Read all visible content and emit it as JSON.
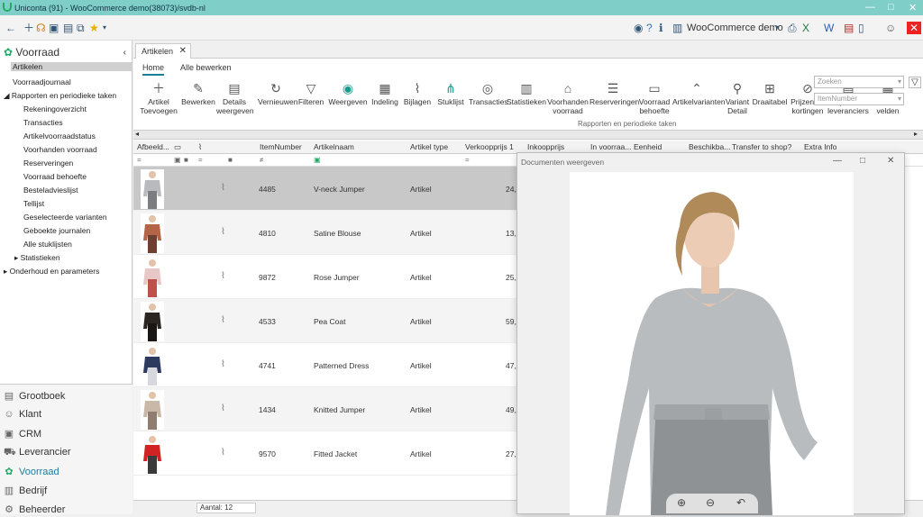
{
  "titlebar": {
    "title": "Uniconta (91)  - WooCommerce demo(38073)/svdb-nl"
  },
  "appbar": {
    "company": "WooCommerce demo"
  },
  "sidebar": {
    "header": "Voorraad",
    "items": [
      "Artikelen",
      "Voorraadjournaal",
      "Rapporten en periodieke taken",
      "Rekeningoverzicht",
      "Transacties",
      "Artikelvoorraadstatus",
      "Voorhanden voorraad",
      "Reserveringen",
      "Voorraad behoefte",
      "Besteladvieslijst",
      "Tellijst",
      "Geselecteerde varianten",
      "Geboekte journalen",
      "Alle stuklijsten",
      "Statistieken",
      "Onderhoud en parameters"
    ]
  },
  "modules": [
    "Grootboek",
    "Klant",
    "CRM",
    "Leverancier",
    "Voorraad",
    "Bedrijf",
    "Beheerder"
  ],
  "doctab": {
    "label": "Artikelen"
  },
  "ribbon": {
    "tabs": [
      "Home",
      "Alle bewerken"
    ],
    "buttons": [
      "Artikel Toevoegen",
      "Bewerken",
      "Details weergeven",
      "Vernieuwen",
      "Filteren",
      "Weergeven",
      "Indeling",
      "Bijlagen",
      "Stuklijst",
      "Transacties",
      "Statistieken",
      "Voorhanden voorraad",
      "Reserveringen",
      "Voorraad behoefte",
      "Artikelvarianten",
      "Variant Detail",
      "Draaitabel",
      "Prijzen en kortingen",
      "Lijst van leveranciers",
      "Toon alle velden"
    ],
    "group_label": "Rapporten en periodieke taken",
    "search_placeholder": "Zoeken",
    "search_field": "ItemNumber"
  },
  "grid": {
    "columns": [
      "Afbeeld...",
      "ItemNumber",
      "Artikelnaam",
      "Artikel type",
      "Verkoopprijs 1",
      "Inkoopprijs",
      "In voorraa...",
      "Eenheid",
      "Beschikba...",
      "Transfer to shop?",
      "Extra Info"
    ],
    "rows": [
      {
        "num": "4485",
        "name": "V-neck Jumper",
        "type": "Artikel",
        "price": "24,"
      },
      {
        "num": "4810",
        "name": "Satine Blouse",
        "type": "Artikel",
        "price": "13,"
      },
      {
        "num": "9872",
        "name": "Rose Jumper",
        "type": "Artikel",
        "price": "25,"
      },
      {
        "num": "4533",
        "name": "Pea Coat",
        "type": "Artikel",
        "price": "59,"
      },
      {
        "num": "4741",
        "name": "Patterned Dress",
        "type": "Artikel",
        "price": "47,"
      },
      {
        "num": "1434",
        "name": "Knitted Jumper",
        "type": "Artikel",
        "price": "49,"
      },
      {
        "num": "9570",
        "name": "Fitted Jacket",
        "type": "Artikel",
        "price": "27,"
      }
    ]
  },
  "status": {
    "count": "Aantal: 12"
  },
  "docwin": {
    "title": "Documenten weergeven"
  },
  "colors": {
    "accent": "#1a7d9c",
    "titlebar": "#7fcfc8"
  }
}
